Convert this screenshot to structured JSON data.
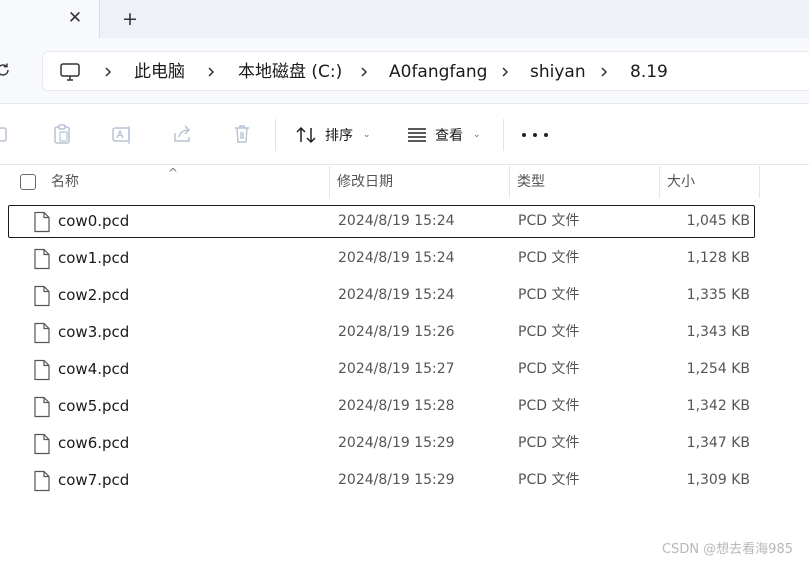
{
  "tab": {
    "close_glyph": "✕",
    "new_tab_glyph": "+"
  },
  "breadcrumb": [
    "此电脑",
    "本地磁盘 (C:)",
    "A0fangfang",
    "shiyan",
    "8.19"
  ],
  "toolbar": {
    "sort_label": "排序",
    "view_label": "查看",
    "icons": [
      "copy-icon",
      "paste-icon",
      "rename-icon",
      "share-icon",
      "delete-icon"
    ]
  },
  "columns": {
    "name": "名称",
    "modified": "修改日期",
    "type": "类型",
    "size": "大小"
  },
  "files": [
    {
      "name": "cow0.pcd",
      "modified": "2024/8/19 15:24",
      "type": "PCD 文件",
      "size": "1,045 KB",
      "focused": true
    },
    {
      "name": "cow1.pcd",
      "modified": "2024/8/19 15:24",
      "type": "PCD 文件",
      "size": "1,128 KB"
    },
    {
      "name": "cow2.pcd",
      "modified": "2024/8/19 15:24",
      "type": "PCD 文件",
      "size": "1,335 KB"
    },
    {
      "name": "cow3.pcd",
      "modified": "2024/8/19 15:26",
      "type": "PCD 文件",
      "size": "1,343 KB"
    },
    {
      "name": "cow4.pcd",
      "modified": "2024/8/19 15:27",
      "type": "PCD 文件",
      "size": "1,254 KB"
    },
    {
      "name": "cow5.pcd",
      "modified": "2024/8/19 15:28",
      "type": "PCD 文件",
      "size": "1,342 KB"
    },
    {
      "name": "cow6.pcd",
      "modified": "2024/8/19 15:29",
      "type": "PCD 文件",
      "size": "1,347 KB"
    },
    {
      "name": "cow7.pcd",
      "modified": "2024/8/19 15:29",
      "type": "PCD 文件",
      "size": "1,309 KB"
    }
  ],
  "watermark": "CSDN @想去看海985",
  "colors": {
    "focus_border": "#1a1a1a",
    "tabbar_bg": "#eef2f8",
    "addr_bg": "#f7f9fc"
  }
}
